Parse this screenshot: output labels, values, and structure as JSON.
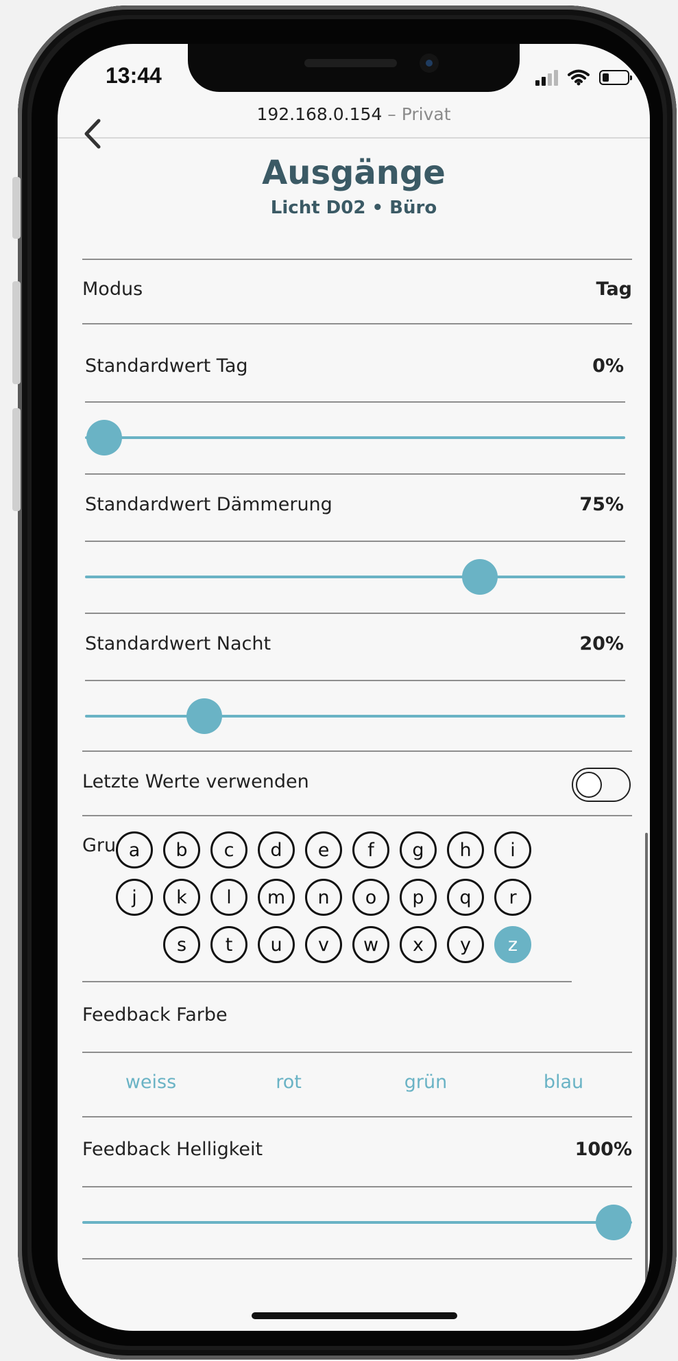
{
  "status_bar": {
    "time": "13:44"
  },
  "browser": {
    "url": "192.168.0.154",
    "separator": " – ",
    "mode": "Privat"
  },
  "header": {
    "title": "Ausgänge",
    "subtitle": "Licht D02 • Büro"
  },
  "mode_row": {
    "label": "Modus",
    "value": "Tag"
  },
  "sliders": [
    {
      "label": "Standardwert Tag",
      "value_text": "0%",
      "value": 0
    },
    {
      "label": "Standardwert Dämmerung",
      "value_text": "75%",
      "value": 75
    },
    {
      "label": "Standardwert Nacht",
      "value_text": "20%",
      "value": 20
    }
  ],
  "last_values": {
    "label": "Letzte Werte verwenden",
    "enabled": false
  },
  "group": {
    "label": "Gruppe",
    "rows": [
      [
        "a",
        "b",
        "c",
        "d",
        "e",
        "f",
        "g",
        "h",
        "i"
      ],
      [
        "j",
        "k",
        "l",
        "m",
        "n",
        "o",
        "p",
        "q",
        "r"
      ],
      [
        "s",
        "t",
        "u",
        "v",
        "w",
        "x",
        "y",
        "z"
      ]
    ],
    "selected": "z"
  },
  "feedback_color": {
    "label": "Feedback Farbe",
    "options": [
      "weiss",
      "rot",
      "grün",
      "blau"
    ]
  },
  "feedback_brightness": {
    "label": "Feedback Helligkeit",
    "value_text": "100%",
    "value": 100
  },
  "colors": {
    "accent": "#6ab3c5",
    "title": "#3b5a65"
  }
}
